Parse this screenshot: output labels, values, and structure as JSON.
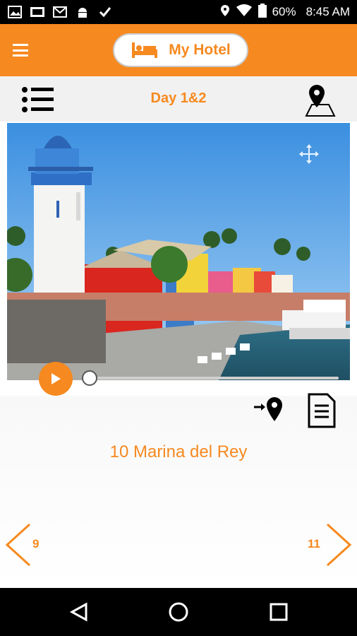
{
  "status_bar": {
    "battery": "60%",
    "time": "8:45 AM",
    "icons": [
      "image-icon",
      "mail-icon",
      "gmail-icon",
      "android-icon",
      "check-icon",
      "location-icon",
      "wifi-icon",
      "battery-icon"
    ]
  },
  "header": {
    "hotel_label": "My Hotel"
  },
  "toolbar": {
    "title": "Day 1&2"
  },
  "stop": {
    "name": "10 Marina del Rey",
    "prev_number": "9",
    "next_number": "11"
  },
  "colors": {
    "accent": "#f6891f",
    "status_bar": "#000000",
    "toolbar_bg": "#f1f1f1"
  }
}
